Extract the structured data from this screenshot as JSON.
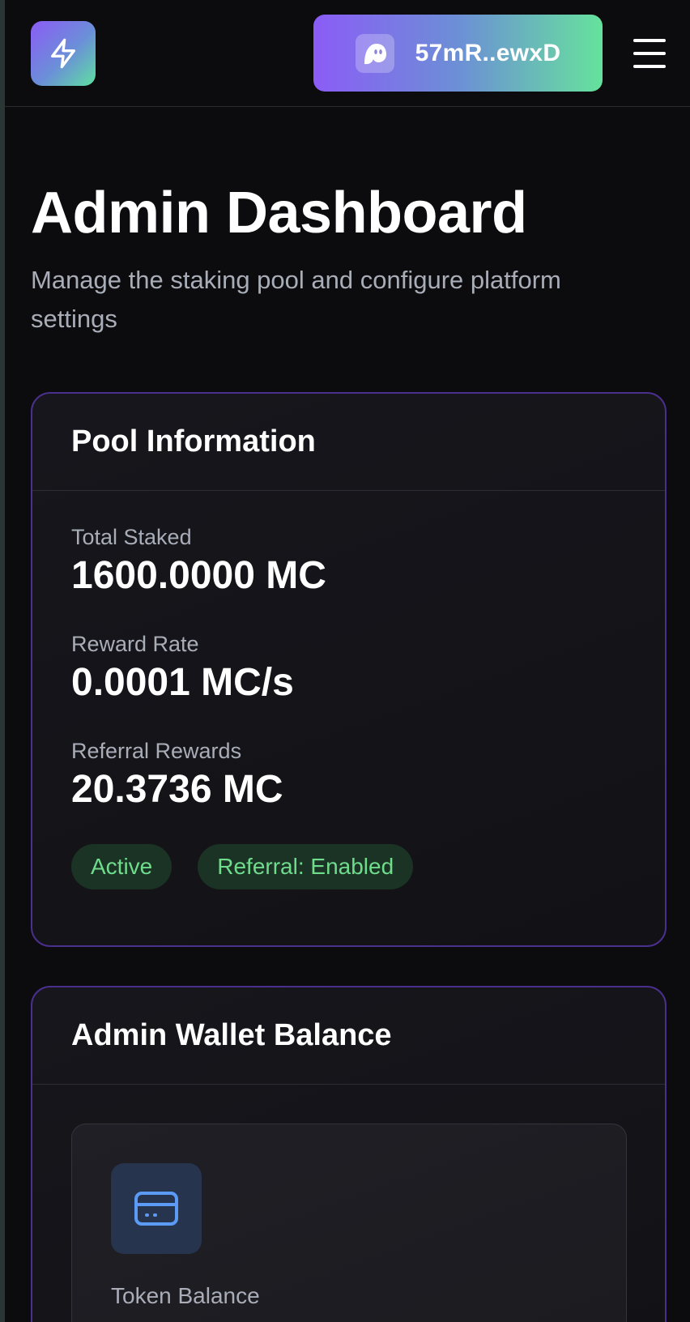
{
  "header": {
    "logo_icon": "lightning-bolt-icon",
    "wallet": {
      "avatar_icon": "ghost-icon",
      "address": "57mR..ewxD"
    },
    "menu_icon": "hamburger-menu-icon"
  },
  "page": {
    "title": "Admin Dashboard",
    "subtitle": "Manage the staking pool and configure platform settings"
  },
  "pool_info": {
    "title": "Pool Information",
    "stats": [
      {
        "label": "Total Staked",
        "value": "1600.0000 MC"
      },
      {
        "label": "Reward Rate",
        "value": "0.0001 MC/s"
      },
      {
        "label": "Referral Rewards",
        "value": "20.3736 MC"
      }
    ],
    "badges": [
      "Active",
      "Referral: Enabled"
    ]
  },
  "admin_wallet": {
    "title": "Admin Wallet Balance",
    "balance_icon": "credit-card-icon",
    "balance_label": "Token Balance"
  },
  "colors": {
    "accent_purple": "#8b5cf6",
    "accent_green": "#5ee0a0",
    "badge_text": "#6fdc8c",
    "card_border": "#4a2f8c"
  }
}
